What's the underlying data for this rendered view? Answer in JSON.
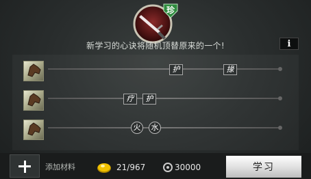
{
  "header": {
    "item_icon": "red-sword-icon",
    "rarity_badge": "珍",
    "notice": "新学习的心诀将随机顶替原来的一个!",
    "info_label": "i"
  },
  "rows": [
    {
      "icon": "beast-head-icon",
      "tags": [
        "护",
        "掾"
      ]
    },
    {
      "icon": "beast-head-icon",
      "tags": [
        "疗",
        "护"
      ]
    },
    {
      "icon": "beast-head-icon",
      "tags": [
        "火",
        "水"
      ]
    }
  ],
  "footer": {
    "add_icon": "plus-icon",
    "add_label": "添加材料",
    "material_count": "21/967",
    "money_amount": "30000",
    "learn_label": "学习"
  },
  "colors": {
    "badge": "#2e8b3e",
    "sword_bg": "#6b1f1f",
    "button_top": "#ffffff",
    "coin": "#e6b800"
  }
}
